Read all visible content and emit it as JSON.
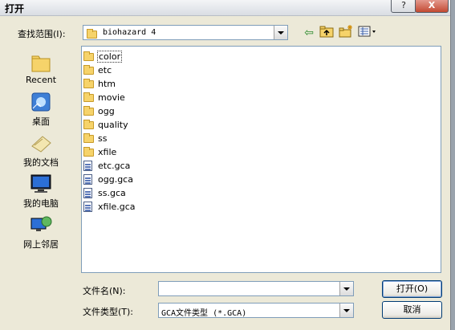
{
  "window": {
    "title": "打开",
    "help_glyph": "?",
    "close_glyph": "X"
  },
  "lookin": {
    "label": "查找范围(I):",
    "value": "biohazard 4"
  },
  "toolbar": {
    "icons": [
      "back-arrow-icon",
      "up-folder-icon",
      "new-folder-icon",
      "view-menu-icon"
    ]
  },
  "places": [
    {
      "label": "Recent",
      "icon": "recent-folder-icon"
    },
    {
      "label": "桌面",
      "icon": "desktop-icon"
    },
    {
      "label": "我的文档",
      "icon": "my-documents-icon"
    },
    {
      "label": "我的电脑",
      "icon": "my-computer-icon"
    },
    {
      "label": "网上邻居",
      "icon": "network-places-icon"
    }
  ],
  "files": [
    {
      "name": "color",
      "type": "folder",
      "selected": true
    },
    {
      "name": "etc",
      "type": "folder"
    },
    {
      "name": "htm",
      "type": "folder"
    },
    {
      "name": "movie",
      "type": "folder"
    },
    {
      "name": "ogg",
      "type": "folder"
    },
    {
      "name": "quality",
      "type": "folder"
    },
    {
      "name": "ss",
      "type": "folder"
    },
    {
      "name": "xfile",
      "type": "folder"
    },
    {
      "name": "etc.gca",
      "type": "file"
    },
    {
      "name": "ogg.gca",
      "type": "file"
    },
    {
      "name": "ss.gca",
      "type": "file"
    },
    {
      "name": "xfile.gca",
      "type": "file"
    }
  ],
  "filename": {
    "label": "文件名(N):",
    "value": ""
  },
  "filetype": {
    "label": "文件类型(T):",
    "value": "GCA文件类型 (*.GCA)"
  },
  "buttons": {
    "open": "打开(O)",
    "cancel": "取消"
  }
}
